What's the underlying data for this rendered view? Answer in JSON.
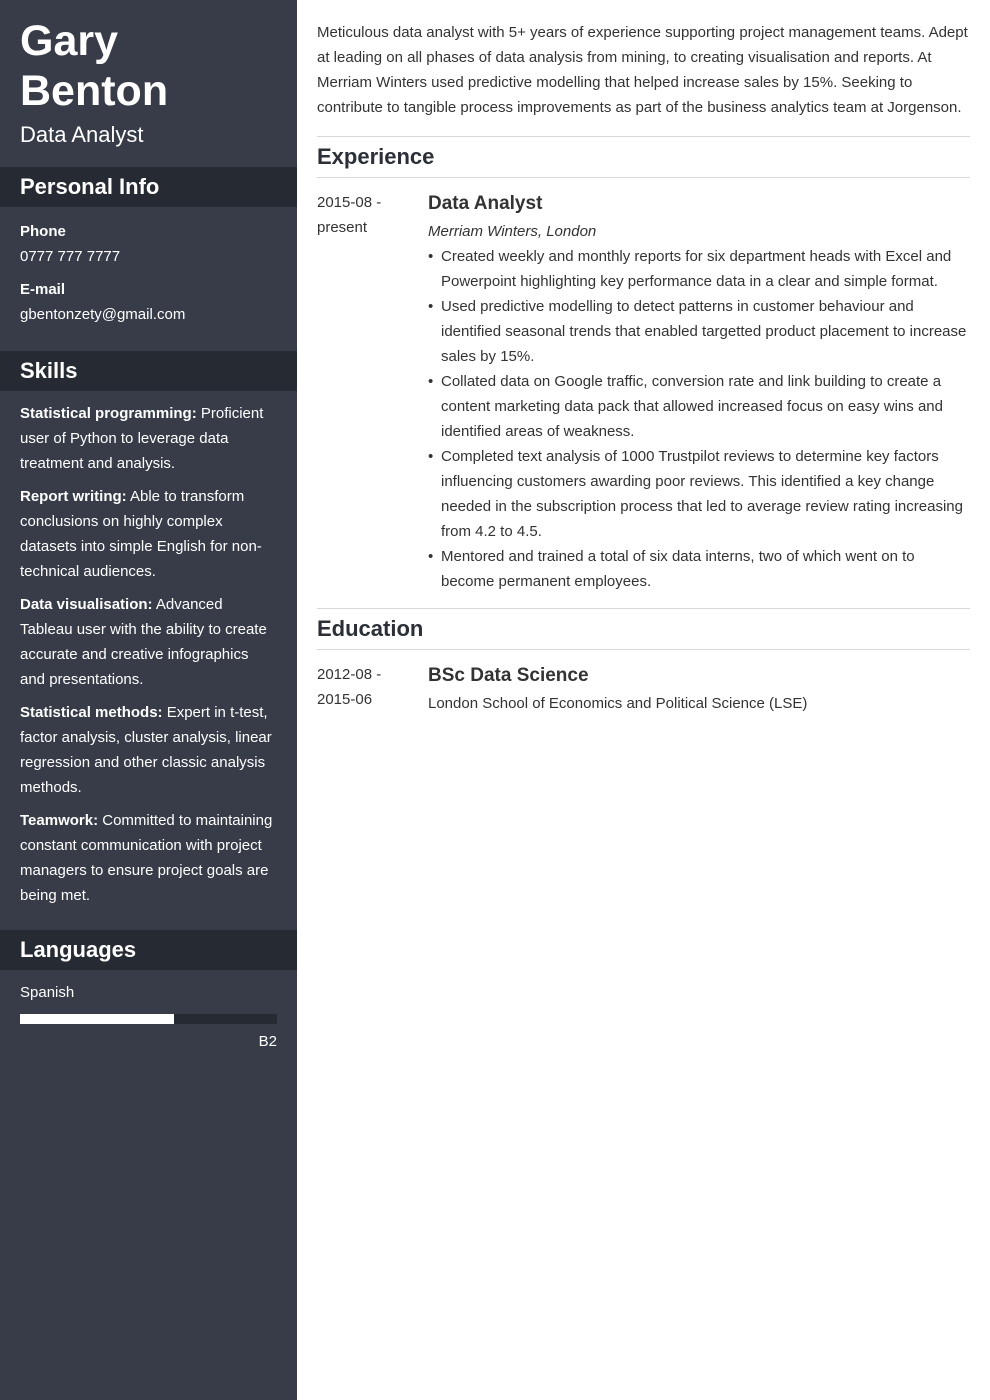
{
  "colors": {
    "sidebar_bg": "#373c48",
    "sidebar_header_bg": "#262a33",
    "main_text": "#333333",
    "rule": "#d8d8d8"
  },
  "profile": {
    "name": "Gary Benton",
    "title": "Data Analyst"
  },
  "personal_info": {
    "heading": "Personal Info",
    "items": [
      {
        "label": "Phone",
        "value": "0777 777 7777"
      },
      {
        "label": "E-mail",
        "value": "gbentonzety@gmail.com"
      }
    ]
  },
  "skills": {
    "heading": "Skills",
    "items": [
      {
        "name": "Statistical programming:",
        "desc": "Proficient user of Python to leverage data treatment and analysis."
      },
      {
        "name": "Report writing:",
        "desc": "Able to transform conclusions on highly complex datasets into simple English for non-technical audiences."
      },
      {
        "name": "Data visualisation:",
        "desc": "Advanced Tableau user with the ability to create accurate and creative infographics and presentations."
      },
      {
        "name": "Statistical methods:",
        "desc": "Expert in t-test, factor analysis, cluster analysis, linear regression and other classic analysis methods."
      },
      {
        "name": "Teamwork:",
        "desc": "Committed to maintaining constant communication with project managers to ensure project goals are being met."
      }
    ]
  },
  "languages": {
    "heading": "Languages",
    "items": [
      {
        "name": "Spanish",
        "level": "B2",
        "proficiency_fraction": 0.6
      }
    ]
  },
  "summary": "Meticulous data analyst with 5+ years of experience supporting project management teams. Adept at leading on all phases of data analysis from mining, to creating visualisation and reports. At Merriam Winters used predictive modelling that helped increase sales by 15%. Seeking to contribute to tangible process improvements as part of the business analytics team at Jorgenson.",
  "experience": {
    "heading": "Experience",
    "entries": [
      {
        "date_start": "2015-08 -",
        "date_end": "present",
        "title": "Data Analyst",
        "company": "Merriam Winters, London",
        "bullet_glyph": "•",
        "bullets": [
          "Created weekly and monthly reports for six department heads with Excel and Powerpoint highlighting key performance data in a clear and simple format.",
          "Used predictive modelling to detect patterns in customer behaviour and identified seasonal trends that enabled targetted product placement to increase sales by 15%.",
          "Collated data on Google traffic, conversion rate and link building to create a content marketing data pack that allowed increased focus on easy wins and identified areas of weakness.",
          "Completed text analysis of 1000 Trustpilot reviews to determine key factors influencing customers awarding poor reviews. This identified a key change needed in the subscription process that led to average review rating increasing from 4.2 to 4.5.",
          "Mentored and trained a total of six data interns, two of which went on to become permanent employees."
        ]
      }
    ]
  },
  "education": {
    "heading": "Education",
    "entries": [
      {
        "date_start": "2012-08 -",
        "date_end": "2015-06",
        "degree": "BSc Data Science",
        "school": "London School of Economics and Political Science (LSE)"
      }
    ]
  }
}
